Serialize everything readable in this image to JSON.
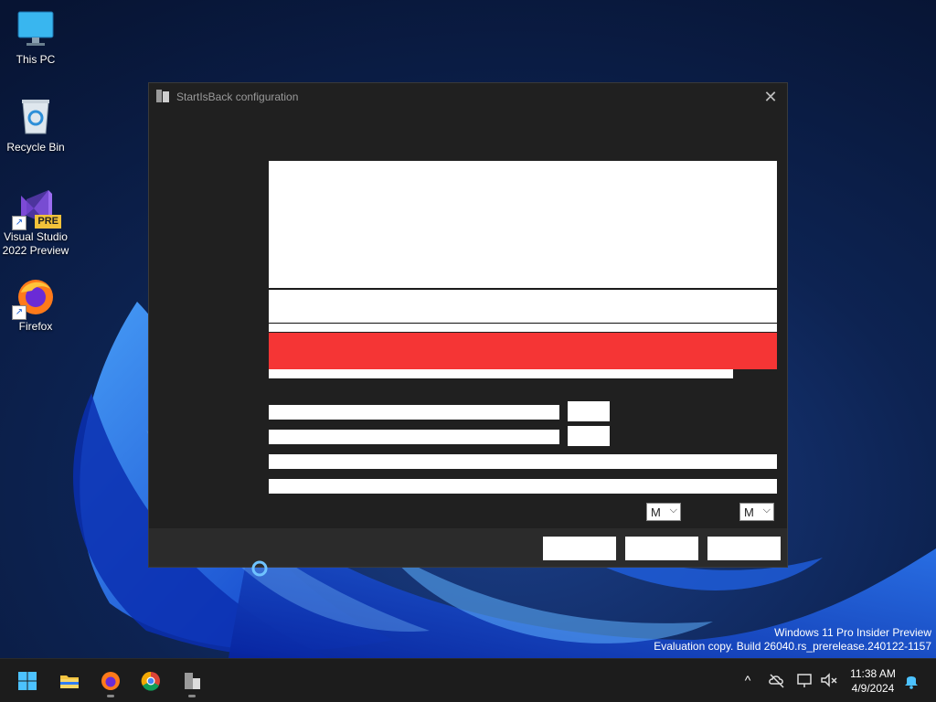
{
  "desktop": {
    "icons": [
      {
        "label": "This PC"
      },
      {
        "label": "Recycle Bin"
      },
      {
        "label_line1": "Visual Studio",
        "label_line2": "2022 Preview",
        "badge": "PRE"
      },
      {
        "label": "Firefox"
      }
    ],
    "watermark": {
      "line1": "Windows 11 Pro Insider Preview",
      "line2": "Evaluation copy. Build 26040.rs_prerelease.240122-1157"
    }
  },
  "window": {
    "title": "StartIsBack configuration",
    "close_glyph": "✕",
    "dropdown_left_value": "M",
    "dropdown_right_value": "M",
    "dropdown_chevron": "⌵"
  },
  "taskbar": {
    "clock_time": "11:38 AM",
    "clock_date": "4/9/2024",
    "chevron": "^"
  },
  "colors": {
    "window_bg": "#202020",
    "footer_bg": "#2b2b2b",
    "accent_red": "#f53535",
    "taskbar_bg": "#1c1c1c"
  }
}
